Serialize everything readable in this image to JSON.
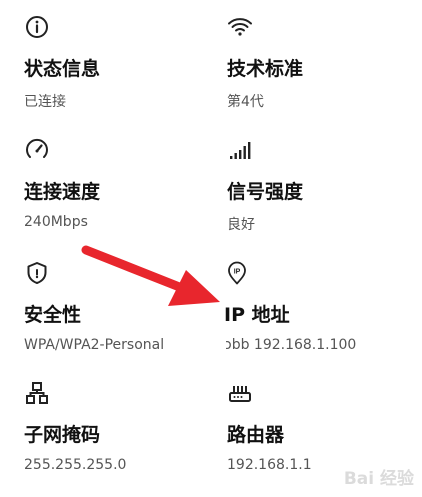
{
  "items": [
    {
      "title": "状态信息",
      "value": "已连接",
      "icon": "info-icon"
    },
    {
      "title": "技术标准",
      "value": "第4代",
      "icon": "wifi-icon"
    },
    {
      "title": "连接速度",
      "value": "240Mbps",
      "icon": "speedometer-icon"
    },
    {
      "title": "信号强度",
      "value": "良好",
      "icon": "signal-bars-icon"
    },
    {
      "title": "安全性",
      "value": "WPA/WPA2-Personal",
      "icon": "shield-icon"
    },
    {
      "title": "IP 地址",
      "value": "ɔbb 192.168.1.100",
      "icon": "location-pin-ip-icon"
    },
    {
      "title": "子网掩码",
      "value": "255.255.255.0",
      "icon": "network-nodes-icon"
    },
    {
      "title": "路由器",
      "value": "192.168.1.1",
      "icon": "router-icon"
    }
  ],
  "annotation": {
    "arrow_color": "#e8262d"
  },
  "watermark": {
    "text": "Bai 经验"
  }
}
